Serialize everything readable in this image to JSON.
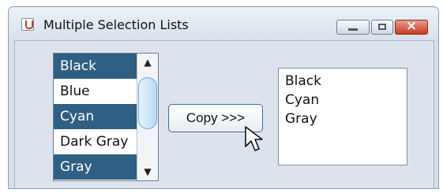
{
  "window": {
    "title": "Multiple Selection Lists",
    "icon": "java-cup-icon",
    "controls": [
      "minimize-icon",
      "maximize-icon",
      "close-icon"
    ],
    "close_symbol": "×"
  },
  "source_list": {
    "items": [
      {
        "label": "Black",
        "selected": true
      },
      {
        "label": "Blue",
        "selected": false
      },
      {
        "label": "Cyan",
        "selected": true
      },
      {
        "label": "Dark Gray",
        "selected": false
      },
      {
        "label": "Gray",
        "selected": true
      }
    ],
    "scroll_up_symbol": "▲",
    "scroll_down_symbol": "▼"
  },
  "copy_button": {
    "label": "Copy >>>"
  },
  "target_list": {
    "items": [
      "Black",
      "Cyan",
      "Gray"
    ]
  },
  "colors": {
    "selected_background": "#2f5f83",
    "selected_text": "#ffffff",
    "accent": "#3f6f98"
  }
}
